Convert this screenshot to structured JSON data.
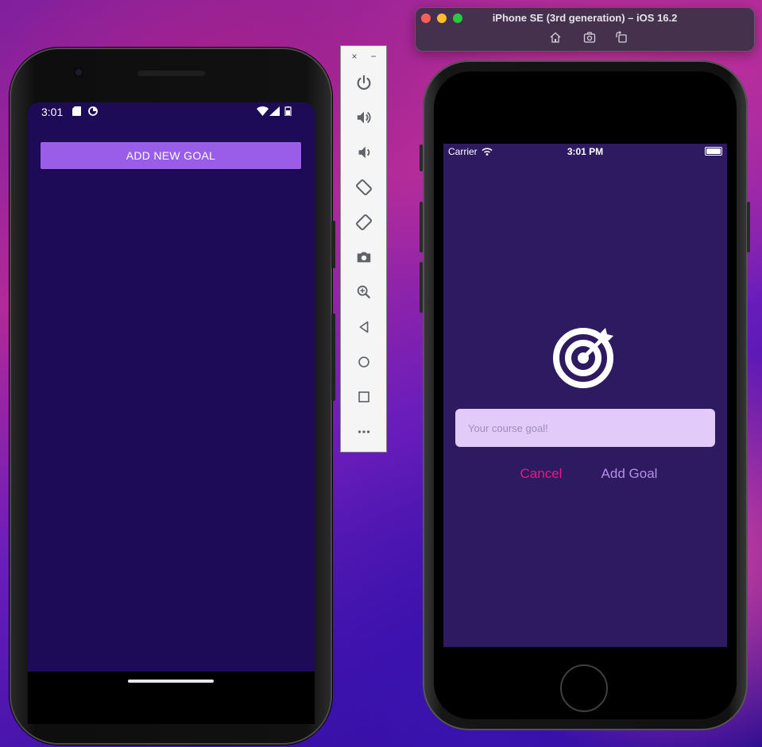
{
  "android": {
    "status_time": "3:01",
    "add_goal_button_label": "ADD NEW GOAL",
    "colors": {
      "screen_bg": "#1e0b57",
      "button_bg": "#9a5de7"
    }
  },
  "emulator_toolbar": {
    "window_buttons": {
      "close": "×",
      "minimize": "−"
    },
    "tools": [
      {
        "name": "power-icon"
      },
      {
        "name": "volume-up-icon"
      },
      {
        "name": "volume-down-icon"
      },
      {
        "name": "rotate-left-icon"
      },
      {
        "name": "rotate-right-icon"
      },
      {
        "name": "camera-icon"
      },
      {
        "name": "zoom-icon"
      },
      {
        "name": "back-icon"
      },
      {
        "name": "home-icon"
      },
      {
        "name": "overview-icon"
      },
      {
        "name": "more-icon"
      }
    ]
  },
  "simulator": {
    "window_title": "iPhone SE (3rd generation) – iOS 16.2",
    "controls": [
      "home-icon",
      "screenshot-icon",
      "rotate-icon"
    ]
  },
  "ios": {
    "carrier": "Carrier",
    "status_time": "3:01 PM",
    "goal_input_placeholder": "Your course goal!",
    "cancel_label": "Cancel",
    "add_goal_label": "Add Goal",
    "colors": {
      "screen_bg": "#2d1a60",
      "input_bg": "#e2cbf9",
      "cancel": "#f31282",
      "add_goal": "#b48ee9"
    }
  }
}
